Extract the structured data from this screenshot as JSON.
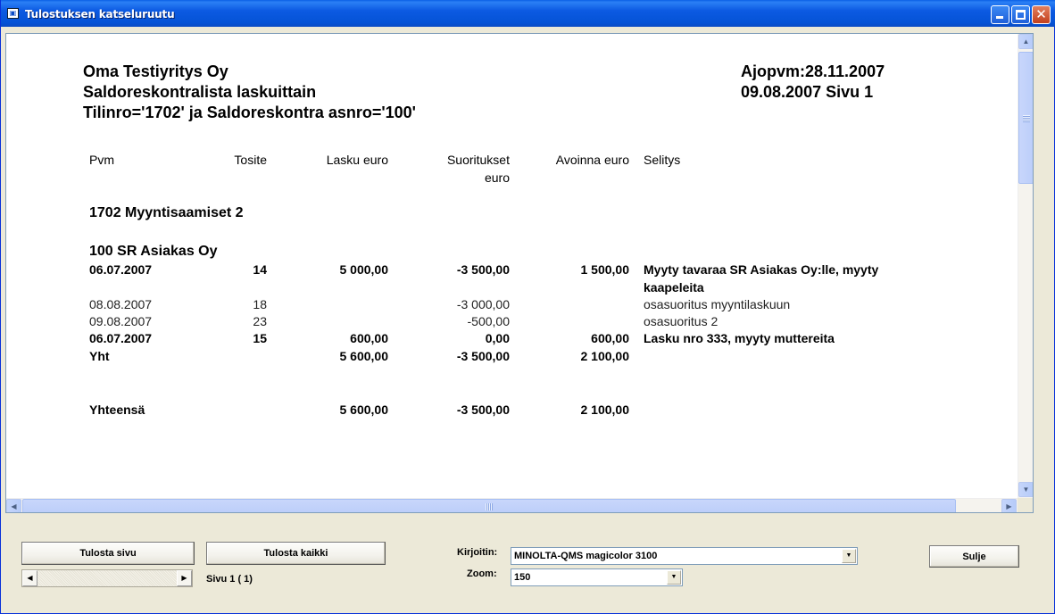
{
  "window": {
    "title": "Tulostuksen katseluruutu"
  },
  "report": {
    "company": "Oma Testiyritys Oy",
    "report_name": "Saldoreskontralista laskuittain",
    "filter": "Tilinro='1702' ja Saldoreskontra asnro='100'",
    "run_date": "Ajopvm:28.11.2007",
    "date_page": "09.08.2007  Sivu 1",
    "columns": {
      "pvm": "Pvm",
      "tosite": "Tosite",
      "lasku": "Lasku euro",
      "suoritukset_1": "Suoritukset",
      "suoritukset_2": "euro",
      "avoinna": "Avoinna euro",
      "selitys": "Selitys"
    },
    "account_heading": "1702 Myyntisaamiset 2",
    "customer_heading": "100 SR Asiakas Oy",
    "rows": [
      {
        "pvm": "06.07.2007",
        "tosite": "14",
        "lasku": "5 000,00",
        "suoritukset": "-3 500,00",
        "avoinna": "1 500,00",
        "selitys": "Myyty tavaraa SR Asiakas Oy:lle, myyty",
        "selitys2": "kaapeleita"
      },
      {
        "pvm": "08.08.2007",
        "tosite": "18",
        "lasku": "",
        "suoritukset": "-3 000,00",
        "avoinna": "",
        "selitys": "osasuoritus myyntilaskuun"
      },
      {
        "pvm": "09.08.2007",
        "tosite": "23",
        "lasku": "",
        "suoritukset": "-500,00",
        "avoinna": "",
        "selitys": "osasuoritus 2"
      },
      {
        "pvm": "06.07.2007",
        "tosite": "15",
        "lasku": "600,00",
        "suoritukset": "0,00",
        "avoinna": "600,00",
        "selitys": "Lasku nro 333, myyty muttereita"
      }
    ],
    "subtotal": {
      "label": "Yht",
      "lasku": "5 600,00",
      "suoritukset": "-3 500,00",
      "avoinna": "2 100,00"
    },
    "total": {
      "label": "Yhteensä",
      "lasku": "5 600,00",
      "suoritukset": "-3 500,00",
      "avoinna": "2 100,00"
    }
  },
  "controls": {
    "print_page_label": "Tulosta sivu",
    "print_all_label": "Tulosta kaikki",
    "page_indicator": "Sivu  1 ( 1)",
    "printer_label": "Kirjoitin:",
    "printer_value": "MINOLTA-QMS magicolor 3100",
    "zoom_label": "Zoom:",
    "zoom_value": "150",
    "close_label": "Sulje"
  }
}
